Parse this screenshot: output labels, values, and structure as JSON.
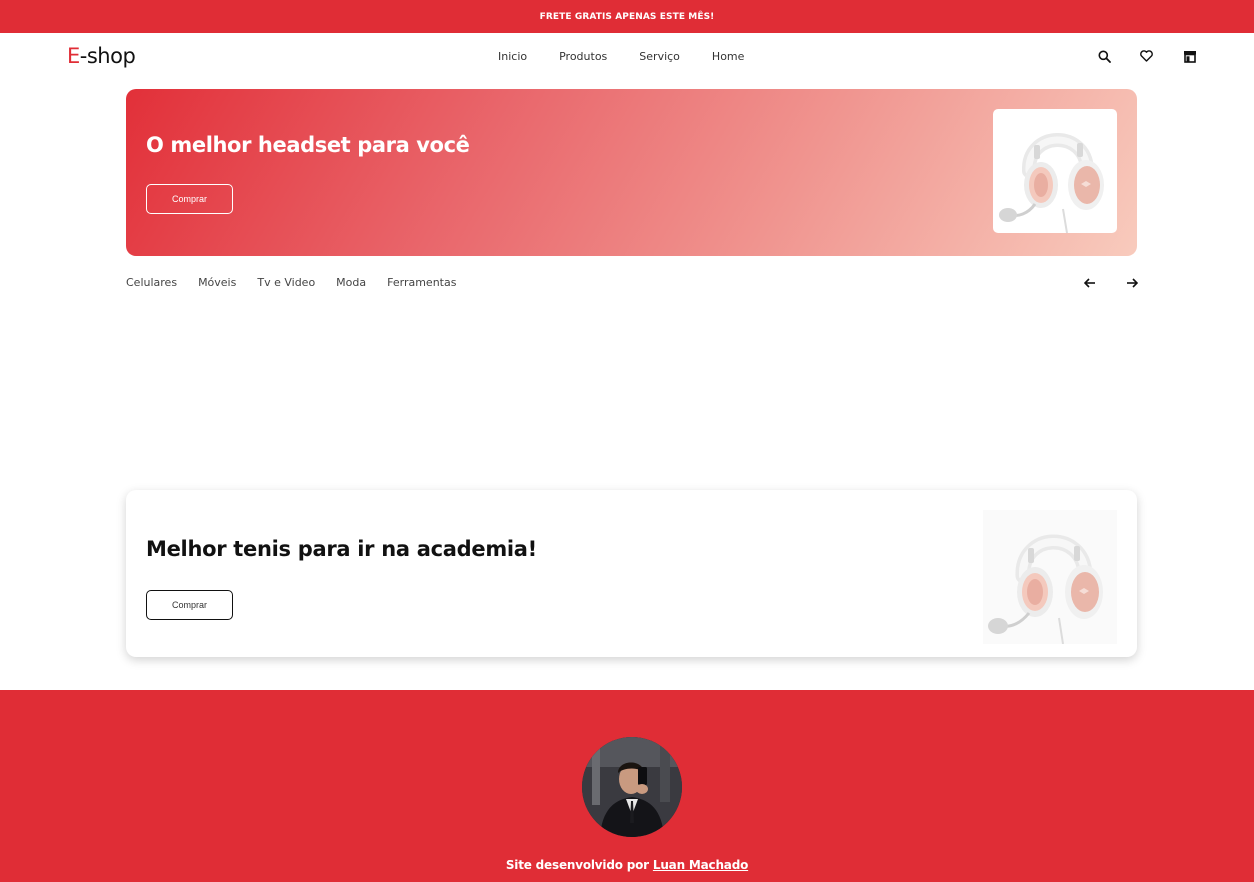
{
  "announcement": {
    "text": "FRETE GRATIS APENAS ESTE MÊS!"
  },
  "header": {
    "logo_accent": "E",
    "logo_rest": "-shop",
    "nav": [
      {
        "label": "Inicio"
      },
      {
        "label": "Produtos"
      },
      {
        "label": "Serviço"
      },
      {
        "label": "Home"
      }
    ],
    "icons": [
      "search-icon",
      "heart-icon",
      "store-icon"
    ]
  },
  "hero": {
    "title": "O melhor headset para você",
    "button_label": "Comprar",
    "image_icon": "headset-image"
  },
  "categories": [
    {
      "label": "Celulares"
    },
    {
      "label": "Móveis"
    },
    {
      "label": "Tv e Video"
    },
    {
      "label": "Moda"
    },
    {
      "label": "Ferramentas"
    }
  ],
  "carousel": {
    "prev_icon": "arrow-left-icon",
    "next_icon": "arrow-right-icon"
  },
  "promo": {
    "title": "Melhor tenis para ir na academia!",
    "button_label": "Comprar",
    "image_icon": "headset-image"
  },
  "footer": {
    "credit_prefix": "Site desenvolvido por",
    "credit_name": "Luan Machado",
    "avatar_icon": "profile-photo"
  },
  "colors": {
    "brand": "#e02d36",
    "white": "#ffffff",
    "text": "#111111"
  }
}
